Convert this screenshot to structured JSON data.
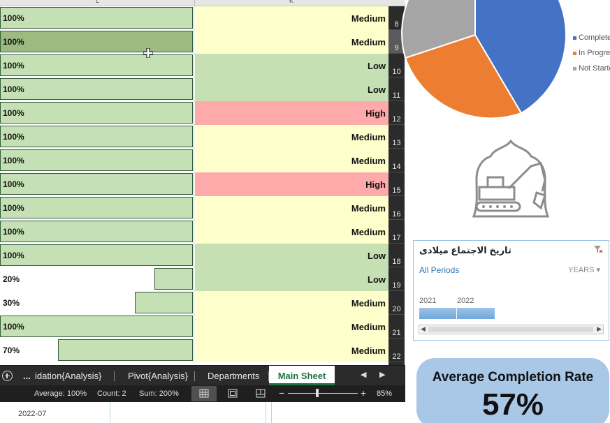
{
  "background": {
    "date_label": "2022-07"
  },
  "excel": {
    "column_headers": [
      "L",
      "K"
    ],
    "rows": [
      {
        "row_number": "8",
        "completion": "100%",
        "completion_value": 1.0,
        "priority": "Medium"
      },
      {
        "row_number": "9",
        "completion": "100%",
        "completion_value": 1.0,
        "priority": "Medium",
        "selected": true
      },
      {
        "row_number": "10",
        "completion": "100%",
        "completion_value": 1.0,
        "priority": "Low"
      },
      {
        "row_number": "11",
        "completion": "100%",
        "completion_value": 1.0,
        "priority": "Low"
      },
      {
        "row_number": "12",
        "completion": "100%",
        "completion_value": 1.0,
        "priority": "High"
      },
      {
        "row_number": "13",
        "completion": "100%",
        "completion_value": 1.0,
        "priority": "Medium"
      },
      {
        "row_number": "14",
        "completion": "100%",
        "completion_value": 1.0,
        "priority": "Medium"
      },
      {
        "row_number": "15",
        "completion": "100%",
        "completion_value": 1.0,
        "priority": "High"
      },
      {
        "row_number": "16",
        "completion": "100%",
        "completion_value": 1.0,
        "priority": "Medium"
      },
      {
        "row_number": "17",
        "completion": "100%",
        "completion_value": 1.0,
        "priority": "Medium"
      },
      {
        "row_number": "18",
        "completion": "100%",
        "completion_value": 1.0,
        "priority": "Low"
      },
      {
        "row_number": "19",
        "completion": "20%",
        "completion_value": 0.2,
        "priority": "Low"
      },
      {
        "row_number": "20",
        "completion": "30%",
        "completion_value": 0.3,
        "priority": "Medium"
      },
      {
        "row_number": "21",
        "completion": "100%",
        "completion_value": 1.0,
        "priority": "Medium"
      },
      {
        "row_number": "22",
        "completion": "70%",
        "completion_value": 0.7,
        "priority": "Medium"
      }
    ],
    "sheet_tabs": {
      "more": "...",
      "tabs": [
        "idation{Analysis}",
        "Pivot{Analysis}",
        "Departments",
        "Main Sheet"
      ],
      "active": "Main Sheet"
    },
    "status_bar": {
      "average": "Average: 100%",
      "count": "Count: 2",
      "sum": "Sum: 200%",
      "zoom_minus": "−",
      "zoom_plus": "+",
      "zoom": "85%"
    },
    "colors": {
      "bar_fill": "#c5e0b4",
      "bar_border": "#355e3b",
      "high": "#ffaaaa",
      "medium": "#ffffcc",
      "low": "#c6e0b4",
      "accent": "#217346"
    }
  },
  "dashboard": {
    "pie_legend": [
      {
        "label": "Complete",
        "color": "#4472c4"
      },
      {
        "label": "In Progre",
        "color": "#ed7d31"
      },
      {
        "label": "Not Starte",
        "color": "#a5a5a5"
      }
    ],
    "logo_icon": "excavator-in-mosque-dome-icon",
    "slicer": {
      "title": "تاريخ الاجتماع ميلادى",
      "all_periods": "All Periods",
      "level": "YEARS ▾",
      "years": [
        "2021",
        "2022"
      ]
    },
    "kpi": {
      "label": "Average Completion Rate",
      "value": "57%"
    }
  }
}
